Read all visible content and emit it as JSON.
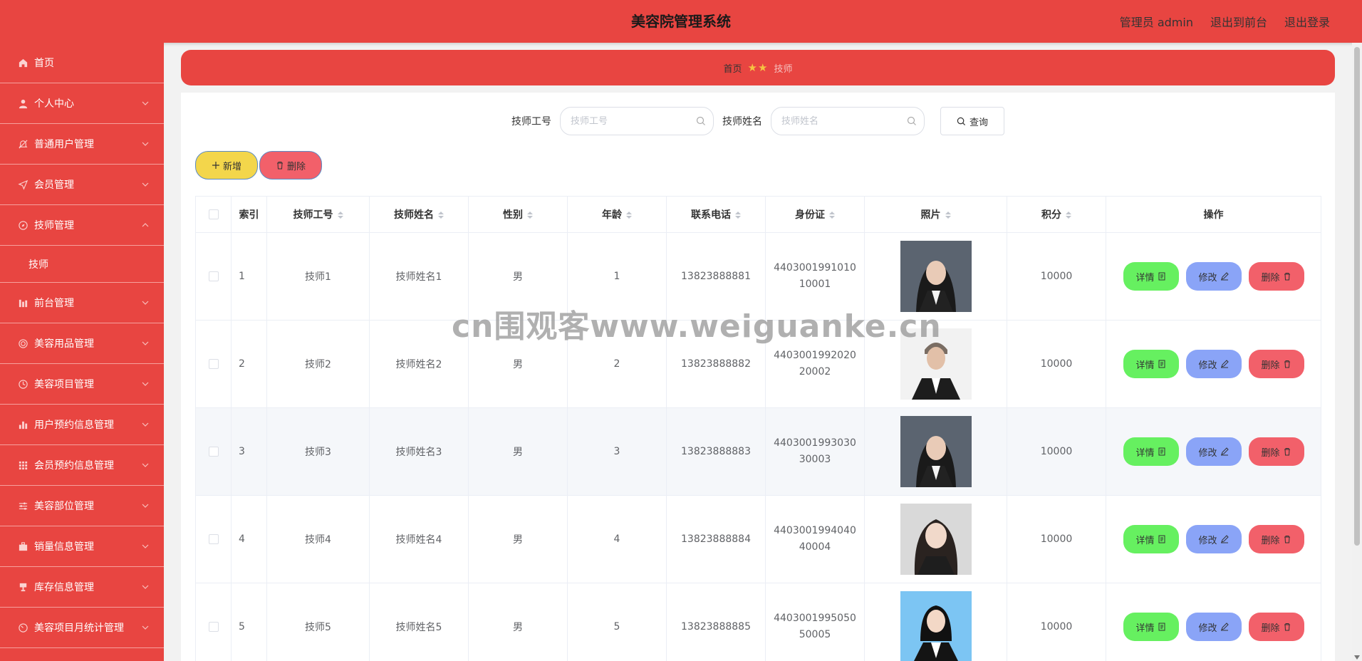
{
  "header": {
    "title": "美容院管理系统",
    "admin": "管理员 admin",
    "to_front": "退出到前台",
    "logout": "退出登录"
  },
  "sidebar": {
    "items": [
      {
        "label": "首页",
        "icon": "home-icon"
      },
      {
        "label": "个人中心",
        "icon": "user-icon"
      },
      {
        "label": "普通用户管理",
        "icon": "bell-off-icon"
      },
      {
        "label": "会员管理",
        "icon": "send-icon"
      },
      {
        "label": "技师管理",
        "icon": "compass-icon"
      },
      {
        "label": "前台管理",
        "icon": "chart-icon"
      },
      {
        "label": "美容用品管理",
        "icon": "gear-icon"
      },
      {
        "label": "美容项目管理",
        "icon": "clock-icon"
      },
      {
        "label": "用户预约信息管理",
        "icon": "bar-chart-icon"
      },
      {
        "label": "会员预约信息管理",
        "icon": "grid-icon"
      },
      {
        "label": "美容部位管理",
        "icon": "sliders-icon"
      },
      {
        "label": "销量信息管理",
        "icon": "briefcase-icon"
      },
      {
        "label": "库存信息管理",
        "icon": "trophy-icon"
      },
      {
        "label": "美容项目月统计管理",
        "icon": "timer-icon"
      }
    ],
    "submenu": "技师"
  },
  "breadcrumb": {
    "home": "首页",
    "stars": "★★",
    "current": "技师"
  },
  "search": {
    "label1": "技师工号",
    "placeholder1": "技师工号",
    "label2": "技师姓名",
    "placeholder2": "技师姓名",
    "query": "查询"
  },
  "actions": {
    "add": "新增",
    "delete": "删除"
  },
  "table": {
    "headers": [
      "索引",
      "技师工号",
      "技师姓名",
      "性别",
      "年龄",
      "联系电话",
      "身份证",
      "照片",
      "积分",
      "操作"
    ],
    "rows": [
      {
        "index": "1",
        "no": "技师1",
        "name": "技师姓名1",
        "gender": "男",
        "age": "1",
        "phone": "13823888881",
        "id": "440300199101010001",
        "points": "10000"
      },
      {
        "index": "2",
        "no": "技师2",
        "name": "技师姓名2",
        "gender": "男",
        "age": "2",
        "phone": "13823888882",
        "id": "440300199202020002",
        "points": "10000"
      },
      {
        "index": "3",
        "no": "技师3",
        "name": "技师姓名3",
        "gender": "男",
        "age": "3",
        "phone": "13823888883",
        "id": "440300199303030003",
        "points": "10000"
      },
      {
        "index": "4",
        "no": "技师4",
        "name": "技师姓名4",
        "gender": "男",
        "age": "4",
        "phone": "13823888884",
        "id": "440300199404040004",
        "points": "10000"
      },
      {
        "index": "5",
        "no": "技师5",
        "name": "技师姓名5",
        "gender": "男",
        "age": "5",
        "phone": "13823888885",
        "id": "440300199505050005",
        "points": "10000"
      }
    ],
    "op_detail": "详情",
    "op_edit": "修改",
    "op_delete": "删除"
  },
  "watermark": "cn围观客www.weiguanke.cn",
  "colors": {
    "primary": "#e84541",
    "add": "#f3d64b",
    "danger": "#f2606a",
    "detail": "#66f060",
    "edit": "#8aa4f7"
  }
}
